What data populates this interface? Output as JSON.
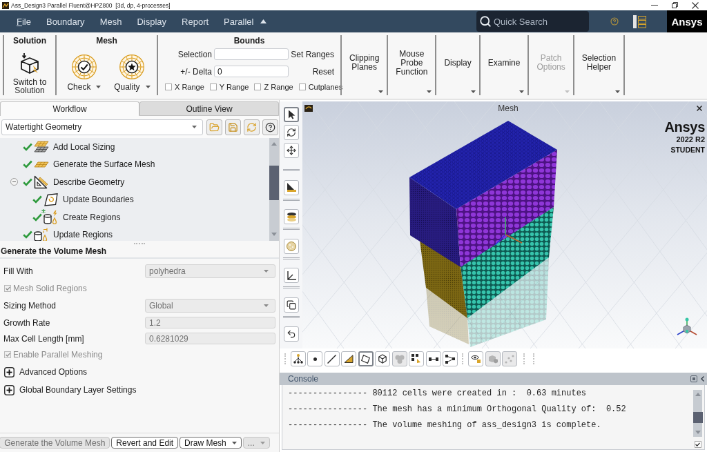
{
  "window": {
    "title": "Ass_Design3 Parallel Fluent@HPZ800  [3d, dp, 4-processes]"
  },
  "menu_bar": {
    "items": [
      {
        "label": "File",
        "mnemonic": true
      },
      {
        "label": "Boundary",
        "mnemonic": false
      },
      {
        "label": "Mesh",
        "mnemonic": false
      },
      {
        "label": "Display",
        "mnemonic": false
      },
      {
        "label": "Report",
        "mnemonic": false
      },
      {
        "label": "Parallel",
        "mnemonic": false
      }
    ],
    "quick_search": {
      "placeholder": "Quick Search"
    },
    "logo": "Ansys"
  },
  "ribbon": {
    "groups": [
      {
        "kind": "solution",
        "title": "Solution",
        "button": "Switch to Solution"
      },
      {
        "kind": "mesh",
        "title": "Mesh",
        "buttons": [
          {
            "kind": "check",
            "label": "Check"
          },
          {
            "kind": "quality",
            "label": "Quality"
          }
        ]
      },
      {
        "kind": "bounds",
        "title": "Bounds",
        "selection": {
          "label": "Selection"
        },
        "delta": {
          "label": "+/- Delta",
          "value": "0"
        },
        "actions": [
          "Set Ranges",
          "Reset"
        ],
        "ranges": [
          {
            "label": "X Range",
            "checked": false
          },
          {
            "label": "Y Range",
            "checked": false
          },
          {
            "label": "Z Range",
            "checked": false
          }
        ],
        "cutplanes": {
          "label": "Cutplanes",
          "checked": false
        }
      },
      {
        "kind": "menu",
        "label": "Clipping Planes",
        "disabled": false
      },
      {
        "kind": "menu",
        "label": "Mouse Probe Function",
        "disabled": false
      },
      {
        "kind": "menu",
        "label": "Display",
        "disabled": false
      },
      {
        "kind": "menu",
        "label": "Examine",
        "disabled": false
      },
      {
        "kind": "menu",
        "label": "Patch Options",
        "disabled": true
      },
      {
        "kind": "menu",
        "label": "Selection Helper",
        "disabled": false
      }
    ]
  },
  "left_panel": {
    "tabs": [
      {
        "label": "Workflow",
        "selected": true
      },
      {
        "label": "Outline View",
        "selected": false
      }
    ],
    "workflow": {
      "value": "Watertight Geometry"
    },
    "tree": [
      {
        "label": "Add Local Sizing",
        "kind": "local-sizing",
        "done": true,
        "modified": false
      },
      {
        "label": "Generate the Surface Mesh",
        "kind": "surface-mesh",
        "done": true,
        "modified": false
      },
      {
        "label": "Describe Geometry",
        "kind": "describe-geometry",
        "done": true,
        "modified": false,
        "expanded": true,
        "children": [
          {
            "label": "Update Boundaries",
            "kind": "update-boundaries",
            "done": true,
            "modified": false
          },
          {
            "label": "Create Regions",
            "kind": "create-regions",
            "done": true,
            "modified": true
          }
        ]
      },
      {
        "label": "Update Regions",
        "kind": "update-regions",
        "done": true,
        "modified": false
      }
    ],
    "task": {
      "title": "Generate the Volume Mesh",
      "fields": [
        {
          "kind": "select",
          "label": "Fill With",
          "value": "polyhedra",
          "disabled": true
        },
        {
          "kind": "checkbox",
          "label": "Mesh Solid Regions",
          "checked": true,
          "disabled": true
        },
        {
          "kind": "select",
          "label": "Sizing Method",
          "value": "Global",
          "disabled": true
        },
        {
          "kind": "number",
          "label": "Growth Rate",
          "value": "1.2",
          "disabled": true
        },
        {
          "kind": "number",
          "label": "Max Cell Length [mm]",
          "value": "0.6281029",
          "disabled": true
        },
        {
          "kind": "checkbox",
          "label": "Enable Parallel Meshing",
          "checked": true,
          "disabled": true
        },
        {
          "kind": "section",
          "label": "Advanced Options",
          "expanded": false
        },
        {
          "kind": "section",
          "label": "Global Boundary Layer Settings",
          "expanded": false
        }
      ],
      "buttons": [
        {
          "label": "Generate the Volume Mesh",
          "disabled": true,
          "dropdown": false
        },
        {
          "label": "Revert and Edit",
          "disabled": false,
          "dropdown": false
        },
        {
          "label": "Draw Mesh",
          "disabled": false,
          "dropdown": true
        },
        {
          "label": "...",
          "disabled": true,
          "dropdown": true
        }
      ]
    }
  },
  "graphics": {
    "side_toolbar": [
      {
        "tools": [
          {
            "kind": "pointer",
            "selected": true
          },
          {
            "kind": "rotate",
            "selected": false
          },
          {
            "kind": "pan",
            "selected": false
          }
        ]
      },
      {
        "tools": [
          {
            "kind": "view",
            "selected": false
          }
        ]
      },
      {
        "tools": [
          {
            "kind": "slice",
            "selected": false
          }
        ]
      },
      {
        "tools": [
          {
            "kind": "sphere",
            "selected": false
          }
        ]
      },
      {
        "tools": [
          {
            "kind": "axes",
            "selected": false
          }
        ]
      },
      {
        "tools": [
          {
            "kind": "copy",
            "selected": false
          }
        ]
      },
      {
        "tools": [
          {
            "kind": "undo",
            "selected": false
          }
        ]
      }
    ],
    "title": "Mesh",
    "logo": {
      "brand": "Ansys",
      "version": "2022 R2",
      "edition": "STUDENT"
    },
    "bottom_toolbar": [
      {
        "tools": [
          {
            "kind": "tree",
            "selected": false,
            "disabled": false
          },
          {
            "kind": "point",
            "selected": false,
            "disabled": false
          },
          {
            "kind": "line",
            "selected": false,
            "disabled": false
          },
          {
            "kind": "triangle",
            "selected": false,
            "disabled": false
          },
          {
            "kind": "face",
            "selected": true,
            "disabled": false
          },
          {
            "kind": "cube",
            "selected": false,
            "disabled": false
          },
          {
            "kind": "cells",
            "selected": false,
            "disabled": true
          },
          {
            "kind": "select-grid",
            "selected": false,
            "disabled": false
          },
          {
            "kind": "edge",
            "selected": false,
            "disabled": false
          },
          {
            "kind": "nodes",
            "selected": false,
            "disabled": false
          }
        ]
      },
      {
        "tools": [
          {
            "kind": "view-filter",
            "selected": false,
            "disabled": false
          },
          {
            "kind": "solid",
            "selected": false,
            "disabled": true
          },
          {
            "kind": "scatter",
            "selected": false,
            "disabled": true
          }
        ]
      }
    ]
  },
  "console": {
    "title": "Console",
    "lines": [
      "---------------- 80112 cells were created in :  0.63 minutes",
      "---------------- The mesh has a minimum Orthogonal Quality of:  0.52",
      "---------------- The volume meshing of ass_design3 is complete."
    ],
    "checkbox": {
      "checked": true
    }
  }
}
